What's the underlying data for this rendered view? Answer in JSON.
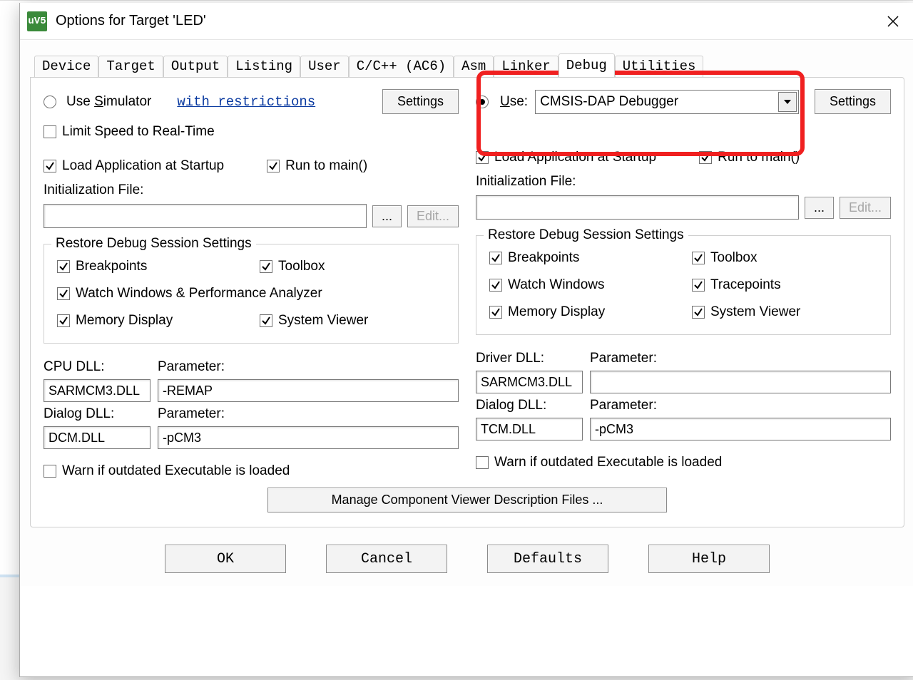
{
  "window": {
    "title": "Options for Target 'LED'",
    "app_icon_text": "uV5"
  },
  "tabs": [
    "Device",
    "Target",
    "Output",
    "Listing",
    "User",
    "C/C++ (AC6)",
    "Asm",
    "Linker",
    "Debug",
    "Utilities"
  ],
  "active_tab": "Debug",
  "left": {
    "use_simulator": "Use Simulator",
    "with_restrictions": "with restrictions",
    "settings": "Settings",
    "limit_speed": "Limit Speed to Real-Time",
    "limit_speed_checked": false,
    "load_app": "Load Application at Startup",
    "load_app_checked": true,
    "run_to_main": "Run to main()",
    "run_to_main_checked": true,
    "init_label": "Initialization File:",
    "init_value": "",
    "browse": "...",
    "edit": "Edit...",
    "group_title": "Restore Debug Session Settings",
    "bp": {
      "label": "Breakpoints",
      "checked": true
    },
    "toolbox": {
      "label": "Toolbox",
      "checked": true
    },
    "watch": {
      "label": "Watch Windows & Performance Analyzer",
      "checked": true
    },
    "mem": {
      "label": "Memory Display",
      "checked": true
    },
    "sysview": {
      "label": "System Viewer",
      "checked": true
    },
    "cpu_dll_label": "CPU DLL:",
    "param_label": "Parameter:",
    "cpu_dll": "SARMCM3.DLL",
    "cpu_param": "-REMAP",
    "dialog_dll_label": "Dialog DLL:",
    "dialog_dll": "DCM.DLL",
    "dialog_param": "-pCM3",
    "warn": "Warn if outdated Executable is loaded",
    "warn_checked": false,
    "radio_selected": false
  },
  "right": {
    "use_label_pre": "U",
    "use_label_post": "se:",
    "radio_selected": true,
    "debugger_selected": "CMSIS-DAP Debugger",
    "settings": "Settings",
    "load_app": "Load Application at Startup",
    "load_app_checked": true,
    "run_to_main": "Run to main()",
    "run_to_main_checked": true,
    "init_label": "Initialization File:",
    "init_value": "",
    "browse": "...",
    "edit": "Edit...",
    "group_title": "Restore Debug Session Settings",
    "bp": {
      "label": "Breakpoints",
      "checked": true
    },
    "toolbox": {
      "label": "Toolbox",
      "checked": true
    },
    "watch": {
      "label": "Watch Windows",
      "checked": true
    },
    "trace": {
      "label": "Tracepoints",
      "checked": true
    },
    "mem": {
      "label": "Memory Display",
      "checked": true
    },
    "sysview": {
      "label": "System Viewer",
      "checked": true
    },
    "driver_dll_label": "Driver DLL:",
    "param_label": "Parameter:",
    "driver_dll": "SARMCM3.DLL",
    "driver_param": "",
    "dialog_dll_label": "Dialog DLL:",
    "dialog_dll": "TCM.DLL",
    "dialog_param": "-pCM3",
    "warn": "Warn if outdated Executable is loaded",
    "warn_checked": false
  },
  "manage_btn": "Manage Component Viewer Description Files ...",
  "bottom": {
    "ok": "OK",
    "cancel": "Cancel",
    "defaults": "Defaults",
    "help": "Help"
  }
}
